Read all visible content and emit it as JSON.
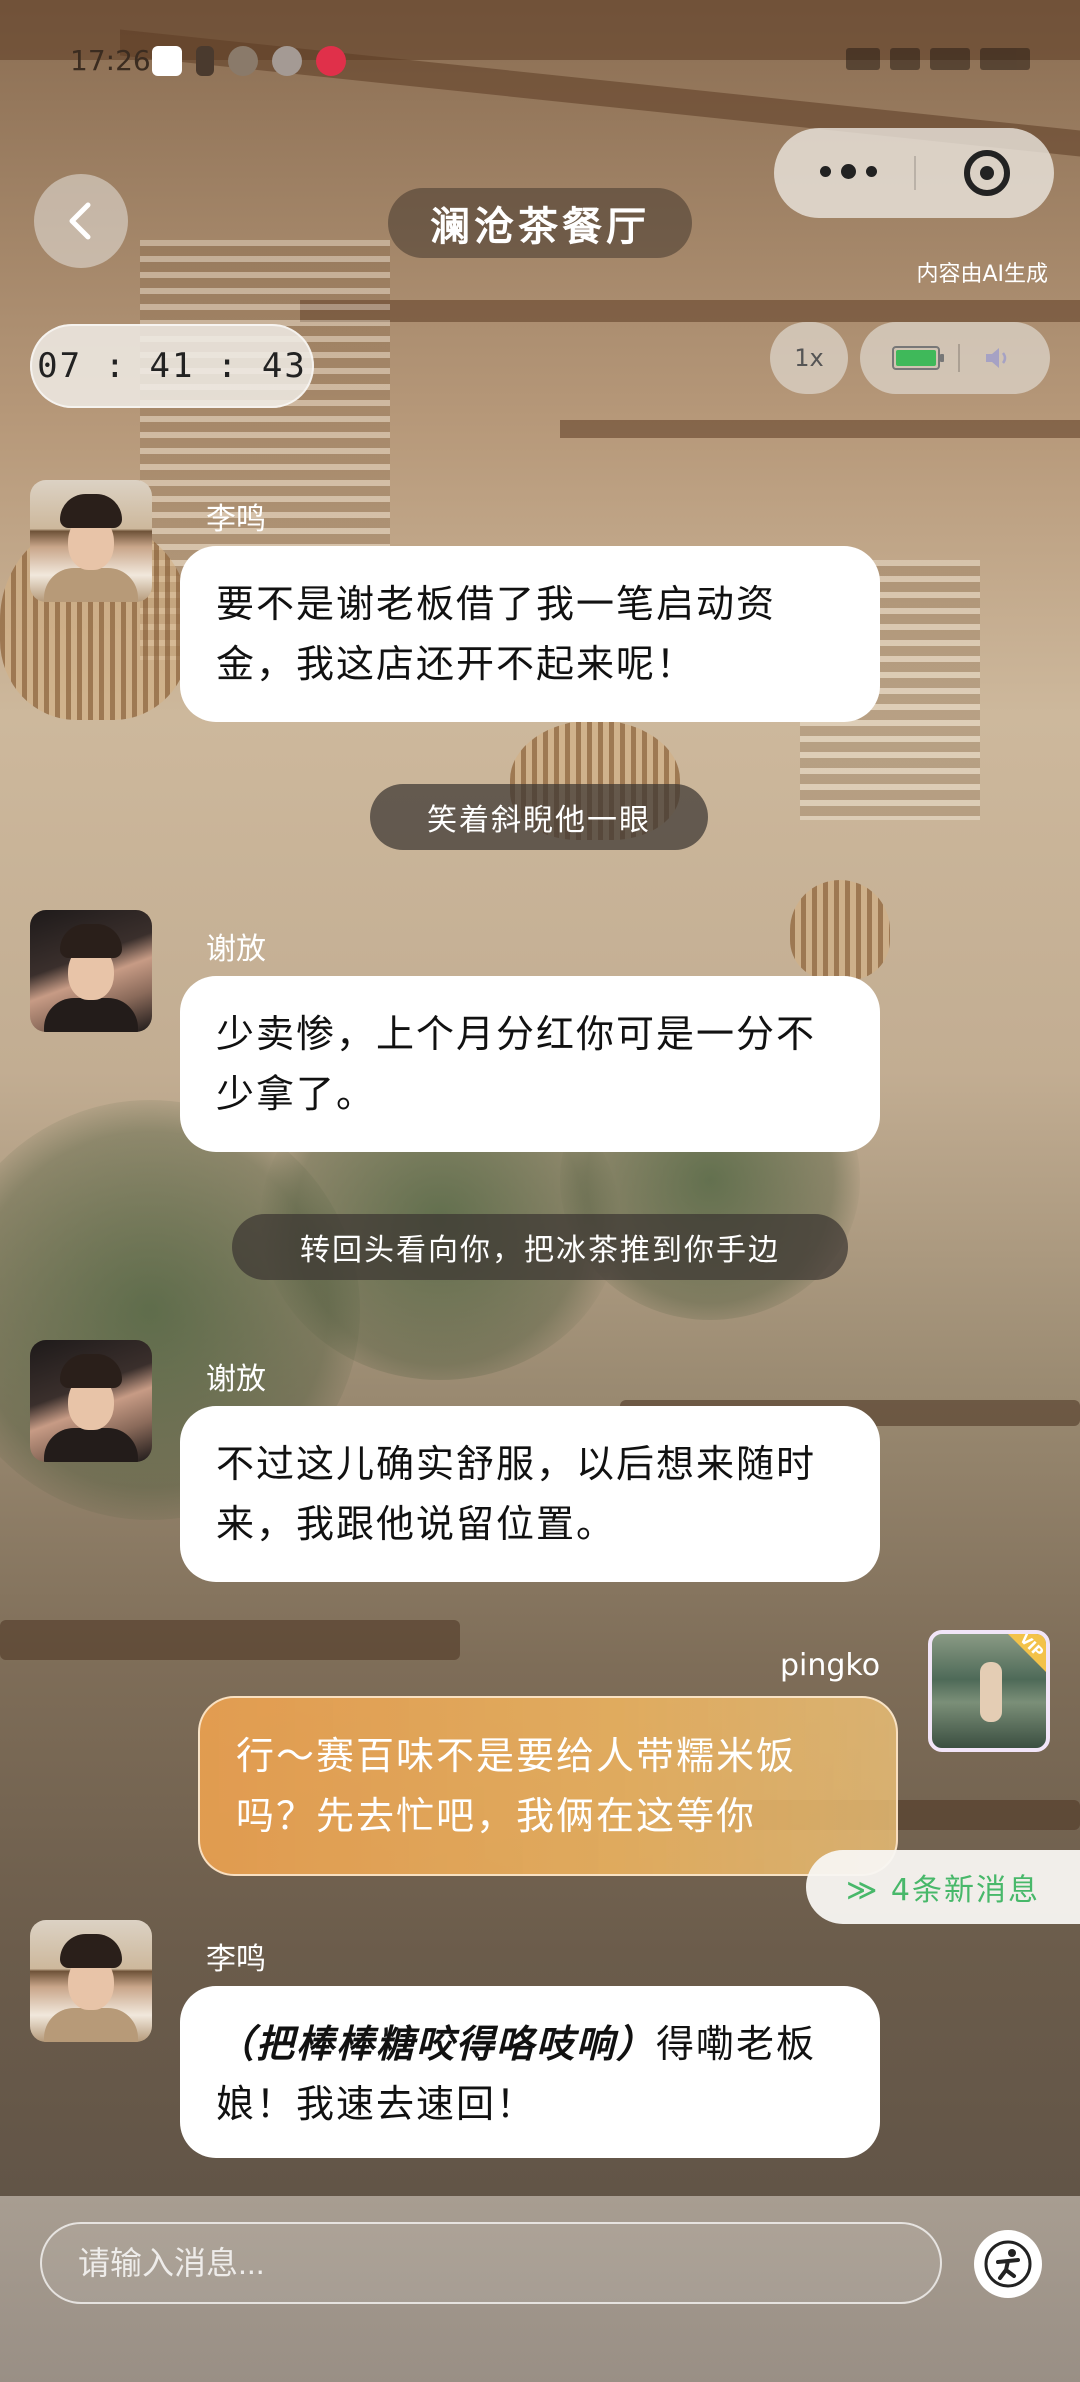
{
  "status_bar": {
    "time": "17:26"
  },
  "header": {
    "title": "澜沧茶餐厅",
    "ai_note": "内容由AI生成",
    "timer": "07 : 41 : 43",
    "speed": "1x"
  },
  "messages": [
    {
      "name": "李鸣",
      "text": "要不是谢老板借了我一笔启动资金，我这店还开不起来呢！"
    },
    {
      "narration": "笑着斜睨他一眼"
    },
    {
      "name": "谢放",
      "text": "少卖惨，上个月分红你可是一分不少拿了。"
    },
    {
      "narration": "转回头看向你，把冰茶推到你手边"
    },
    {
      "name": "谢放",
      "text": "不过这儿确实舒服，以后想来随时来，我跟他说留位置。"
    },
    {
      "name": "pingko",
      "text": "行～赛百味不是要给人带糯米饭吗？先去忙吧，我俩在这等你"
    },
    {
      "name": "李鸣",
      "action": "（把棒棒糖咬得咯吱响）",
      "text": "得嘞老板娘！我速去速回！"
    }
  ],
  "user_avatar": {
    "badge": "VIP"
  },
  "new_messages": "≫ 4条新消息",
  "input": {
    "placeholder": "请输入消息..."
  },
  "icons": {
    "back": "chevron-left-icon",
    "more": "more-dots-icon",
    "close": "target-close-icon",
    "battery": "battery-icon",
    "speaker": "speaker-icon",
    "assist": "accessibility-icon"
  },
  "colors": {
    "user_bubble": "#eaa050",
    "new_msg_text": "#48b86a",
    "narration_bg": "#3c3632"
  }
}
